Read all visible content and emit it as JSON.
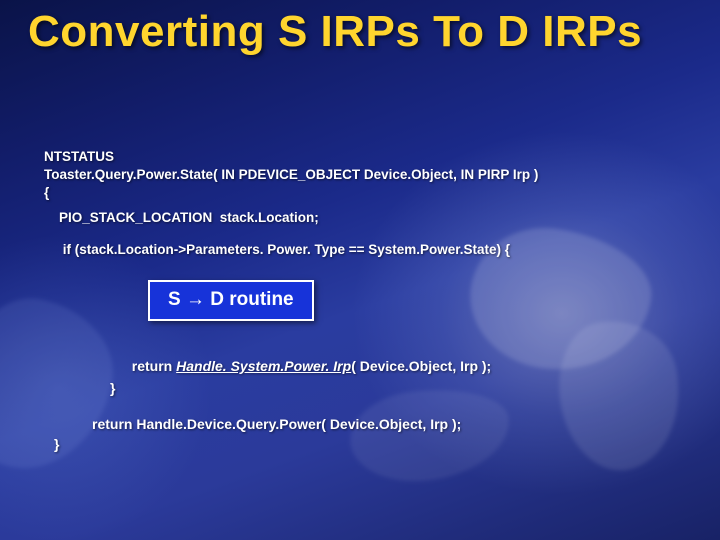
{
  "title": "Converting S IRPs To D IRPs",
  "code": {
    "l1": "NTSTATUS",
    "l2": "Toaster.Query.Power.State( IN PDEVICE_OBJECT Device.Object, IN PIRP Irp )",
    "l3": "{",
    "l4": "    PIO_STACK_LOCATION  stack.Location;",
    "l5": "     if (stack.Location->Parameters. Power. Type == System.Power.State) {"
  },
  "callout": {
    "left": "S ",
    "arrow": "→",
    "right": " D routine"
  },
  "ret1_pre": "return ",
  "ret1_fn": "Handle. System.Power. Irp",
  "ret1_post": "( Device.Object, Irp );",
  "brace_inner": "}",
  "ret2": "return Handle.Device.Query.Power( Device.Object, Irp );",
  "brace_outer": "}"
}
